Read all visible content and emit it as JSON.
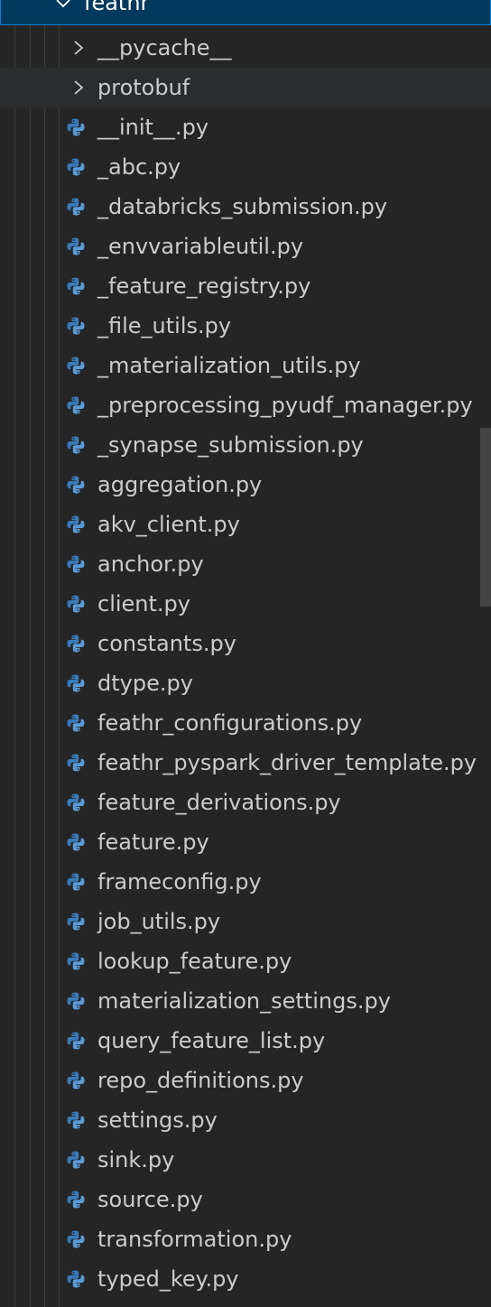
{
  "explorer": {
    "root_folder": {
      "label": "feathr",
      "expanded": true
    },
    "subfolders": [
      {
        "label": "__pycache__",
        "expanded": false
      },
      {
        "label": "protobuf",
        "expanded": false
      }
    ],
    "files": [
      {
        "label": "__init__.py",
        "icon": "python-icon"
      },
      {
        "label": "_abc.py",
        "icon": "python-icon"
      },
      {
        "label": "_databricks_submission.py",
        "icon": "python-icon"
      },
      {
        "label": "_envvariableutil.py",
        "icon": "python-icon"
      },
      {
        "label": "_feature_registry.py",
        "icon": "python-icon"
      },
      {
        "label": "_file_utils.py",
        "icon": "python-icon"
      },
      {
        "label": "_materialization_utils.py",
        "icon": "python-icon"
      },
      {
        "label": "_preprocessing_pyudf_manager.py",
        "icon": "python-icon"
      },
      {
        "label": "_synapse_submission.py",
        "icon": "python-icon"
      },
      {
        "label": "aggregation.py",
        "icon": "python-icon"
      },
      {
        "label": "akv_client.py",
        "icon": "python-icon"
      },
      {
        "label": "anchor.py",
        "icon": "python-icon"
      },
      {
        "label": "client.py",
        "icon": "python-icon"
      },
      {
        "label": "constants.py",
        "icon": "python-icon"
      },
      {
        "label": "dtype.py",
        "icon": "python-icon"
      },
      {
        "label": "feathr_configurations.py",
        "icon": "python-icon"
      },
      {
        "label": "feathr_pyspark_driver_template.py",
        "icon": "python-icon"
      },
      {
        "label": "feature_derivations.py",
        "icon": "python-icon"
      },
      {
        "label": "feature.py",
        "icon": "python-icon"
      },
      {
        "label": "frameconfig.py",
        "icon": "python-icon"
      },
      {
        "label": "job_utils.py",
        "icon": "python-icon"
      },
      {
        "label": "lookup_feature.py",
        "icon": "python-icon"
      },
      {
        "label": "materialization_settings.py",
        "icon": "python-icon"
      },
      {
        "label": "query_feature_list.py",
        "icon": "python-icon"
      },
      {
        "label": "repo_definitions.py",
        "icon": "python-icon"
      },
      {
        "label": "settings.py",
        "icon": "python-icon"
      },
      {
        "label": "sink.py",
        "icon": "python-icon"
      },
      {
        "label": "source.py",
        "icon": "python-icon"
      },
      {
        "label": "transformation.py",
        "icon": "python-icon"
      },
      {
        "label": "typed_key.py",
        "icon": "python-icon"
      }
    ],
    "colors": {
      "background": "#252526",
      "selection_background": "#04395e",
      "selection_border": "#007fd4",
      "hover_background": "#2a2d2e",
      "text": "#cccccc",
      "python_blue": "#3a7bb8",
      "python_blue_light": "#5b9bd5"
    }
  }
}
